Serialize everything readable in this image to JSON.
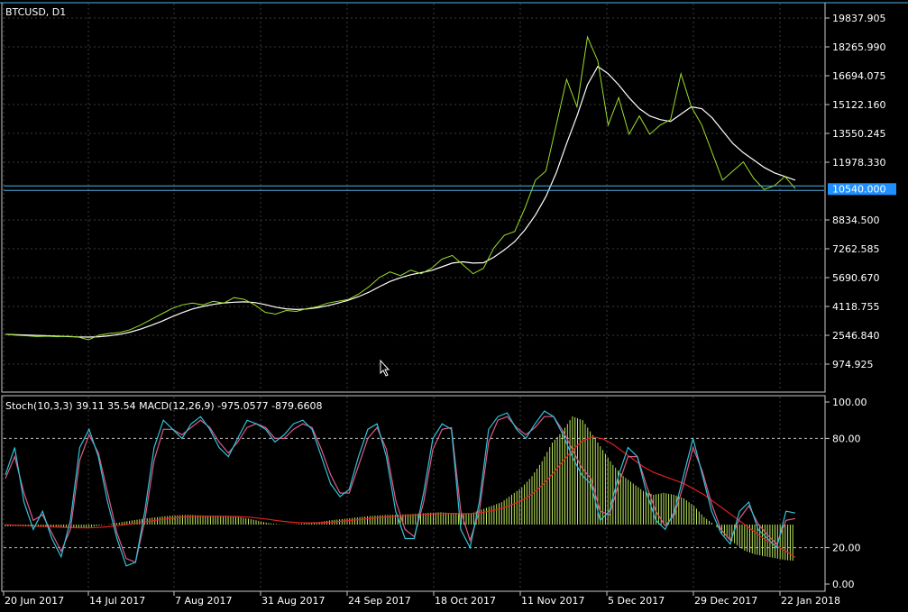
{
  "colors": {
    "background": "#000000",
    "grid": "#3a3a3a",
    "frame": "#c8c8c8",
    "price_line": "#9ADE2A",
    "ma_line": "#FFFFFF",
    "hline": "#4FB3E8",
    "price_tag_bg": "#1E90FF",
    "stoch_main": "#2FC4D8",
    "stoch_signal": "#E05A8A",
    "macd_hist": "#BFEA5A",
    "macd_signal": "#E02020",
    "text": "#FFFFFF"
  },
  "chart_data": [
    {
      "type": "line",
      "title": "BTCUSD, D1",
      "x": [
        "20 Jun 2017",
        "14 Jul 2017",
        "7 Aug 2017",
        "31 Aug 2017",
        "24 Sep 2017",
        "18 Oct 2017",
        "11 Nov 2017",
        "5 Dec 2017",
        "29 Dec 2017",
        "22 Jan 2018"
      ],
      "ylim": [
        0,
        20500
      ],
      "y_ticks": [
        "19837.905",
        "18265.990",
        "16694.075",
        "15122.160",
        "13550.245",
        "11978.330",
        "10540.000",
        "8834.500",
        "7262.585",
        "5690.670",
        "4118.755",
        "2546.840",
        "974.925"
      ],
      "current_price_label": "10540.000",
      "current_price": 10540,
      "series": [
        {
          "key": "close",
          "values": [
            2600,
            2550,
            2520,
            2480,
            2500,
            2470,
            2500,
            2450,
            2300,
            2550,
            2650,
            2700,
            2850,
            3100,
            3400,
            3700,
            4000,
            4200,
            4300,
            4200,
            4400,
            4300,
            4600,
            4500,
            4200,
            3800,
            3700,
            3900,
            3850,
            4000,
            4100,
            4300,
            4400,
            4500,
            4800,
            5200,
            5700,
            6000,
            5800,
            6100,
            5900,
            6200,
            6700,
            6900,
            6400,
            5900,
            6200,
            7300,
            8000,
            8200,
            9500,
            11000,
            11500,
            14000,
            16500,
            15000,
            18800,
            17500,
            14000,
            15500,
            13500,
            14500,
            13500,
            14000,
            14300,
            16800,
            15000,
            14000,
            12500,
            11000,
            11500,
            12000,
            11100,
            10500,
            10700,
            11200,
            10540
          ]
        },
        {
          "key": "moving_average",
          "values": [
            2600,
            2580,
            2560,
            2540,
            2520,
            2500,
            2480,
            2460,
            2450,
            2470,
            2520,
            2600,
            2720,
            2880,
            3080,
            3300,
            3550,
            3780,
            3980,
            4120,
            4230,
            4310,
            4350,
            4370,
            4330,
            4220,
            4080,
            3990,
            3950,
            3980,
            4050,
            4160,
            4300,
            4460,
            4660,
            4900,
            5200,
            5480,
            5680,
            5850,
            5960,
            6080,
            6280,
            6480,
            6550,
            6480,
            6500,
            6800,
            7200,
            7650,
            8300,
            9100,
            10100,
            11400,
            13000,
            14500,
            16200,
            17200,
            16800,
            16200,
            15500,
            14900,
            14500,
            14300,
            14200,
            14600,
            15000,
            14900,
            14400,
            13700,
            13000,
            12500,
            12100,
            11700,
            11400,
            11200,
            11000
          ]
        }
      ]
    },
    {
      "type": "line",
      "title": "Stoch(10,3,3) 39.11 35.54 MACD(12,26,9) -975.0577 -879.6608",
      "ylim": [
        0,
        100
      ],
      "y_ticks": [
        "100.00",
        "80.00",
        "20.00",
        "0.00"
      ],
      "levels": [
        80,
        20
      ],
      "series": [
        {
          "key": "stoch_main",
          "values": [
            60,
            75,
            45,
            30,
            40,
            25,
            15,
            35,
            75,
            85,
            70,
            45,
            25,
            10,
            12,
            40,
            75,
            90,
            85,
            80,
            88,
            92,
            85,
            75,
            70,
            80,
            90,
            88,
            85,
            78,
            82,
            88,
            90,
            85,
            70,
            55,
            48,
            52,
            70,
            85,
            88,
            70,
            40,
            25,
            25,
            50,
            80,
            88,
            85,
            30,
            20,
            45,
            85,
            92,
            94,
            85,
            80,
            88,
            95,
            92,
            82,
            70,
            60,
            55,
            35,
            40,
            60,
            75,
            70,
            50,
            35,
            30,
            40,
            60,
            80,
            60,
            40,
            28,
            22,
            40,
            45,
            30,
            25,
            20,
            40,
            39
          ]
        },
        {
          "key": "stoch_signal",
          "values": [
            58,
            70,
            50,
            35,
            38,
            28,
            18,
            30,
            68,
            82,
            72,
            50,
            28,
            14,
            12,
            35,
            68,
            85,
            85,
            82,
            86,
            90,
            86,
            78,
            72,
            78,
            86,
            88,
            86,
            80,
            80,
            85,
            88,
            86,
            74,
            60,
            50,
            50,
            65,
            80,
            86,
            74,
            46,
            30,
            26,
            45,
            74,
            85,
            86,
            40,
            24,
            40,
            78,
            90,
            92,
            86,
            82,
            86,
            92,
            92,
            84,
            74,
            64,
            58,
            40,
            38,
            55,
            70,
            70,
            54,
            40,
            32,
            38,
            55,
            75,
            62,
            44,
            30,
            24,
            36,
            43,
            33,
            27,
            22,
            35,
            36
          ]
        },
        {
          "key": "macd_histogram",
          "values": [
            -50,
            -40,
            -45,
            -60,
            -70,
            -80,
            -90,
            -95,
            -80,
            -40,
            0,
            40,
            90,
            130,
            170,
            200,
            230,
            250,
            260,
            250,
            240,
            230,
            220,
            200,
            160,
            100,
            40,
            10,
            0,
            20,
            40,
            70,
            110,
            140,
            170,
            200,
            230,
            250,
            260,
            270,
            280,
            300,
            320,
            330,
            310,
            280,
            300,
            400,
            500,
            600,
            800,
            1000,
            1300,
            1700,
            2200,
            2500,
            2900,
            2800,
            2400,
            2000,
            1600,
            1300,
            1100,
            900,
            800,
            850,
            800,
            700,
            500,
            200,
            0,
            -300,
            -500,
            -700,
            -800,
            -850,
            -900,
            -950,
            -975
          ]
        },
        {
          "key": "macd_signal",
          "values": [
            0,
            -20,
            -30,
            -40,
            -55,
            -65,
            -75,
            -85,
            -90,
            -80,
            -60,
            -30,
            0,
            40,
            80,
            120,
            160,
            190,
            210,
            220,
            225,
            225,
            220,
            215,
            200,
            175,
            140,
            100,
            70,
            50,
            45,
            50,
            65,
            85,
            110,
            135,
            165,
            190,
            210,
            230,
            245,
            260,
            280,
            295,
            300,
            295,
            295,
            320,
            370,
            430,
            530,
            650,
            820,
            1050,
            1350,
            1680,
            2000,
            2250,
            2350,
            2300,
            2150,
            1950,
            1750,
            1550,
            1400,
            1300,
            1200,
            1100,
            950,
            800,
            600,
            400,
            200,
            0,
            -200,
            -400,
            -550,
            -700,
            -880
          ]
        }
      ]
    }
  ]
}
